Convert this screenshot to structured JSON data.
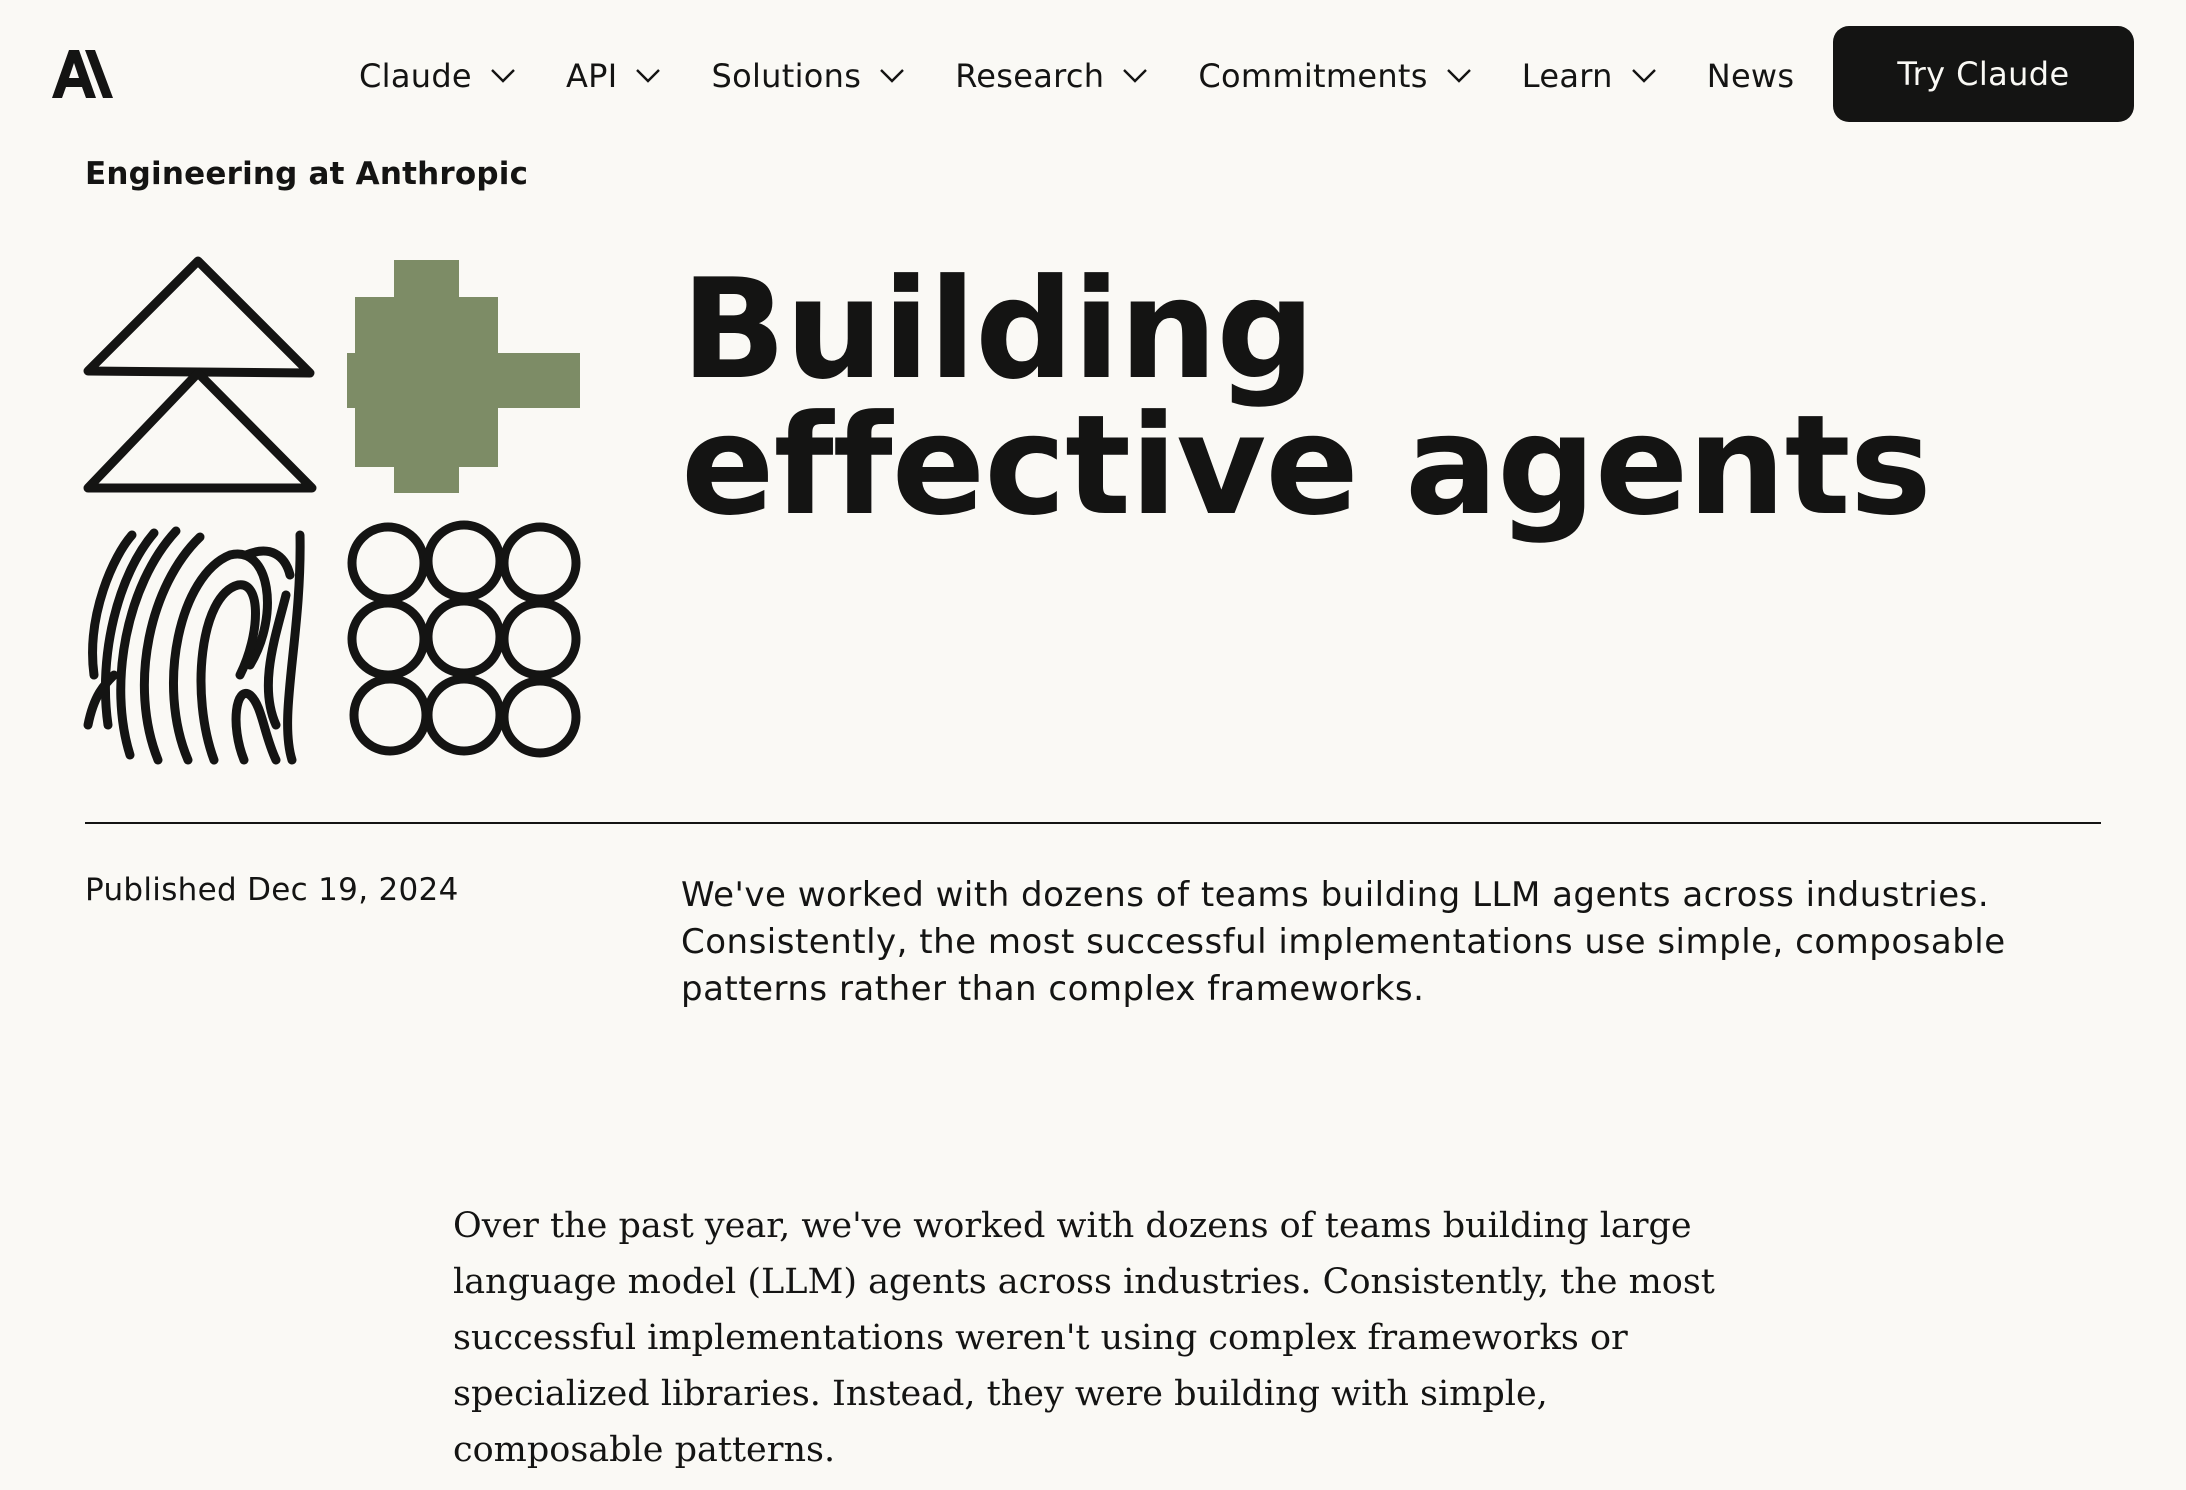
{
  "header": {
    "logo_label": "A\\",
    "nav": [
      {
        "label": "Claude",
        "has_dropdown": true
      },
      {
        "label": "API",
        "has_dropdown": true
      },
      {
        "label": "Solutions",
        "has_dropdown": true
      },
      {
        "label": "Research",
        "has_dropdown": true
      },
      {
        "label": "Commitments",
        "has_dropdown": true
      },
      {
        "label": "Learn",
        "has_dropdown": true
      },
      {
        "label": "News",
        "has_dropdown": false
      }
    ],
    "cta_label": "Try Claude"
  },
  "article": {
    "eyebrow": "Engineering at Anthropic",
    "title": "Building effective agents",
    "published": "Published Dec 19, 2024",
    "summary": "We've worked with dozens of teams building LLM agents across industries. Consistently, the most successful implementations use simple, composable patterns rather than complex frameworks.",
    "intro": "Over the past year, we've worked with dozens of teams building large language model (LLM) agents across industries. Consistently, the most successful implementations weren't using complex frameworks or specialized libraries. Instead, they were building with simple, composable patterns."
  },
  "colors": {
    "background": "#faf9f5",
    "text": "#141413",
    "accent_green": "#7d8c66",
    "button_bg": "#141413",
    "button_text": "#faf9f5"
  },
  "icons": {
    "logo": "anthropic-logo",
    "dropdown": "chevron-down-icon",
    "hero": [
      "stacked-triangles-icon",
      "cross-shape-icon",
      "fingerprint-icon",
      "circle-grid-icon"
    ]
  }
}
